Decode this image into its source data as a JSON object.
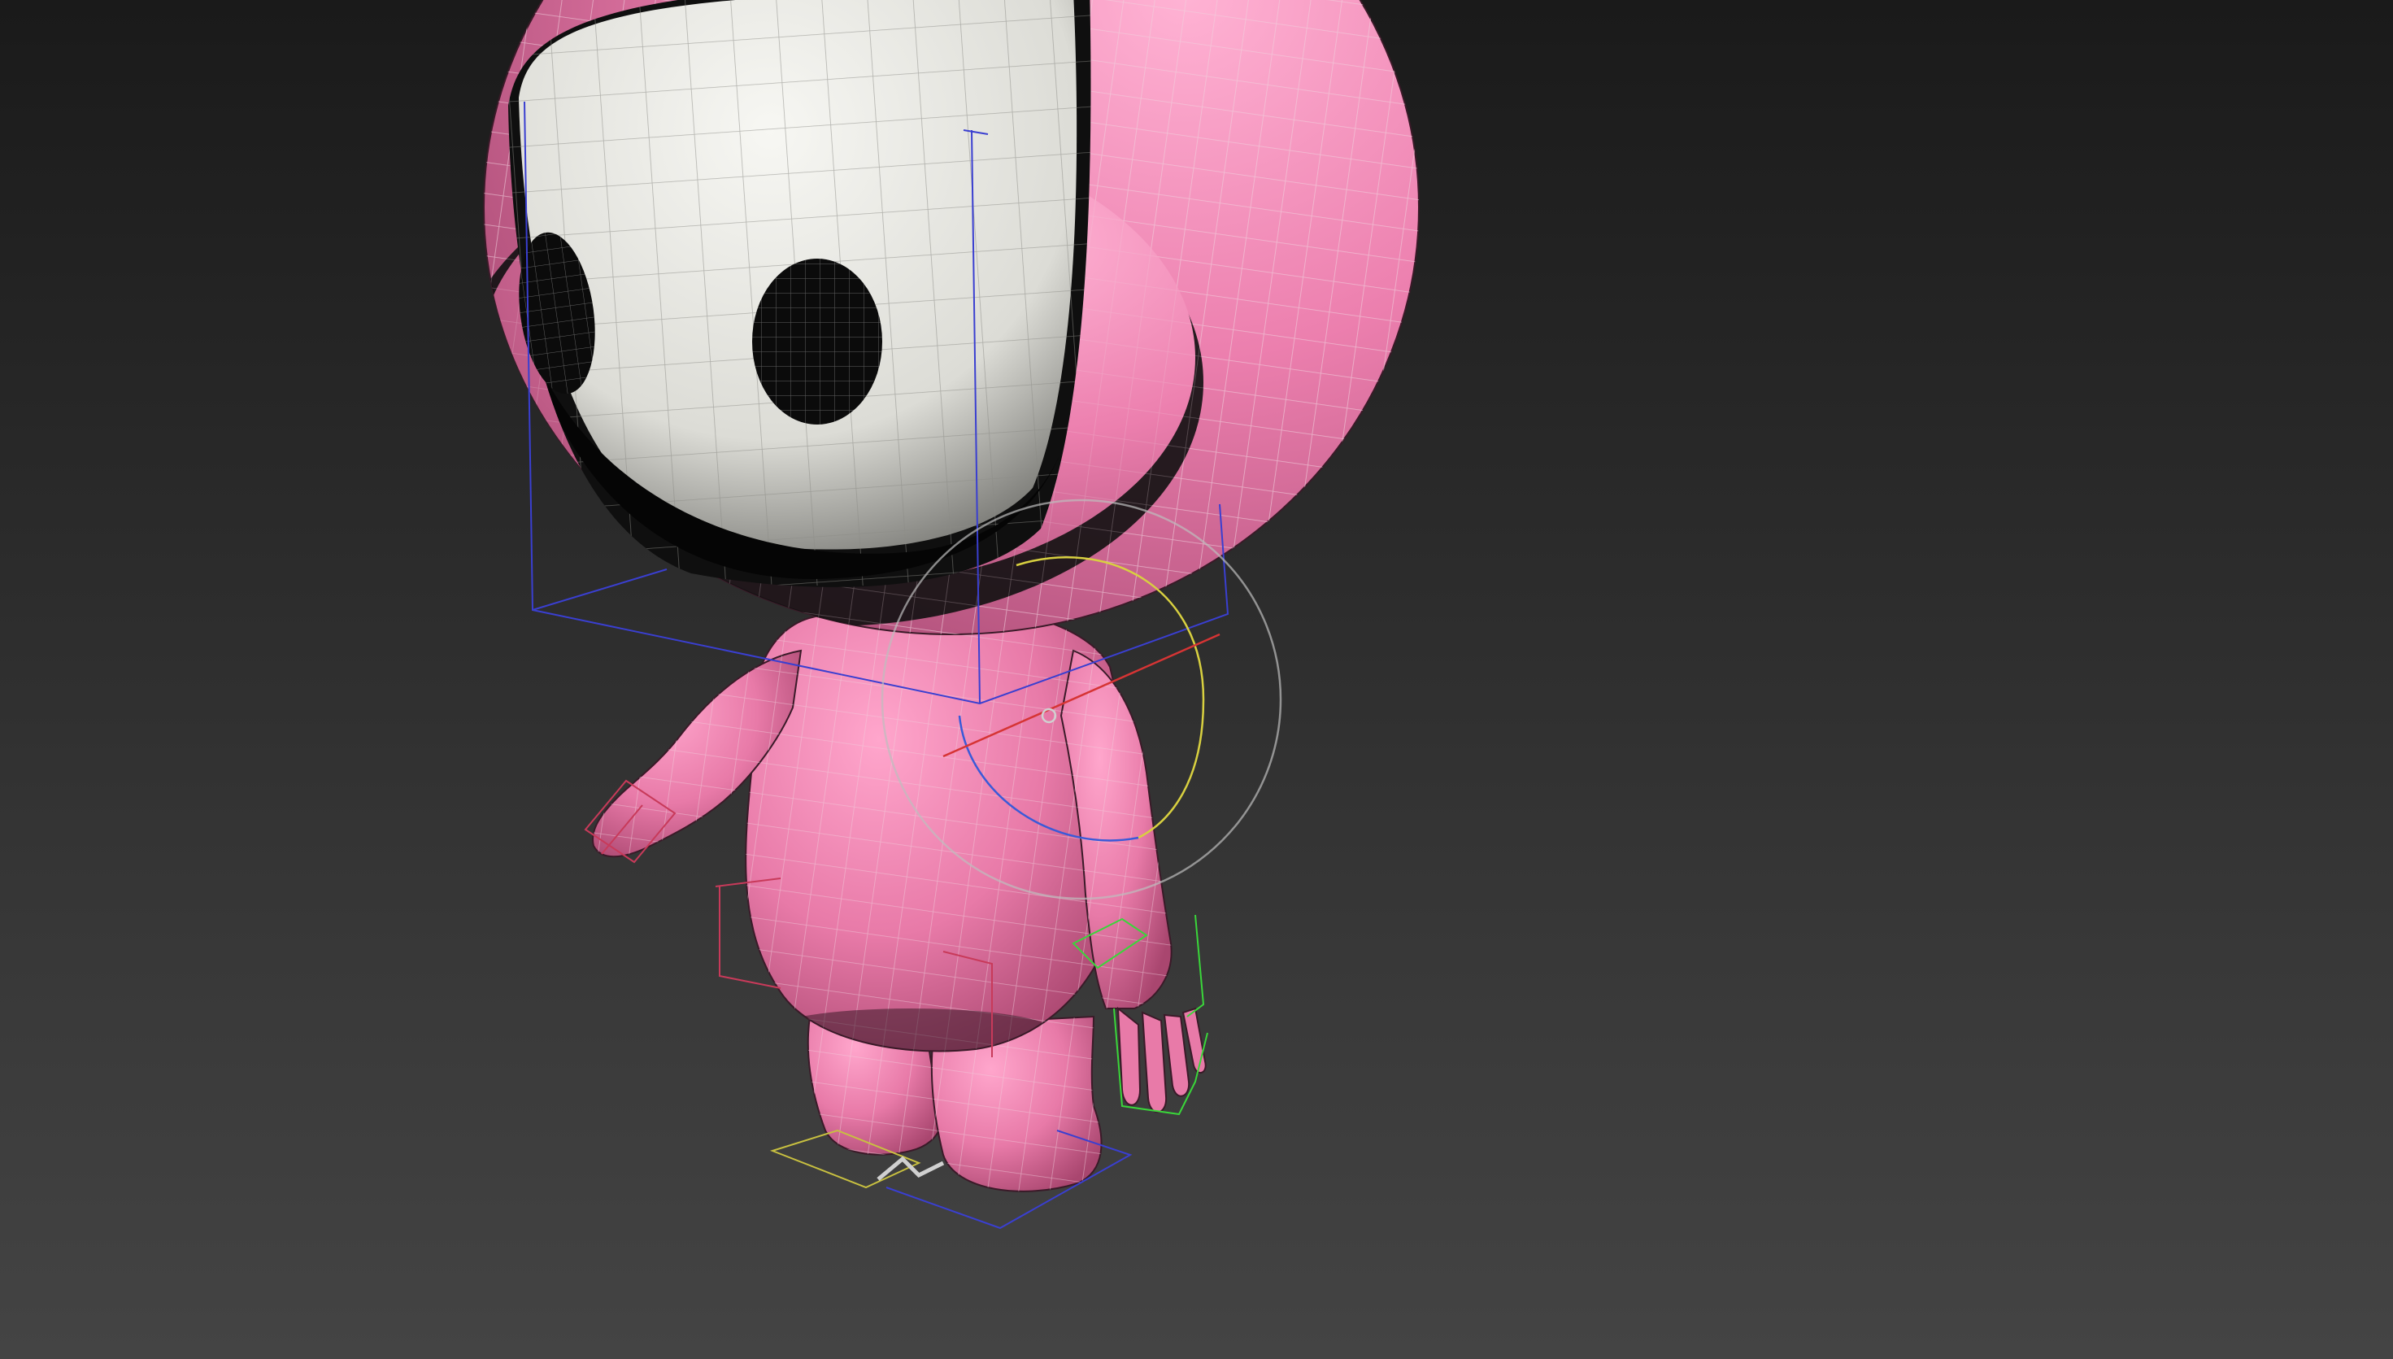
{
  "viewport": {
    "kind": "3d-perspective-viewport",
    "background_top": "#1a1a1a",
    "background_bottom": "#444444"
  },
  "model": {
    "body_color": "#e87aa8",
    "body_shadow": "#b5507e",
    "face_color": "#efefec",
    "eye_color": "#0d0d0d",
    "wireframe_color": "#d9d9d9",
    "display_mode": "shaded-with-edged-faces"
  },
  "gizmos": {
    "bounding_box_color": "#3a3fd0",
    "rotate_x_color": "#d63434",
    "rotate_y_color": "#d8d040",
    "rotate_z_color": "#3a5ad8",
    "view_circle_color": "#bdbdbd",
    "hand_bone_color": "#3ad63a",
    "hip_bone_color": "#c83a5a",
    "foot_bone_color": "#c8c040"
  }
}
